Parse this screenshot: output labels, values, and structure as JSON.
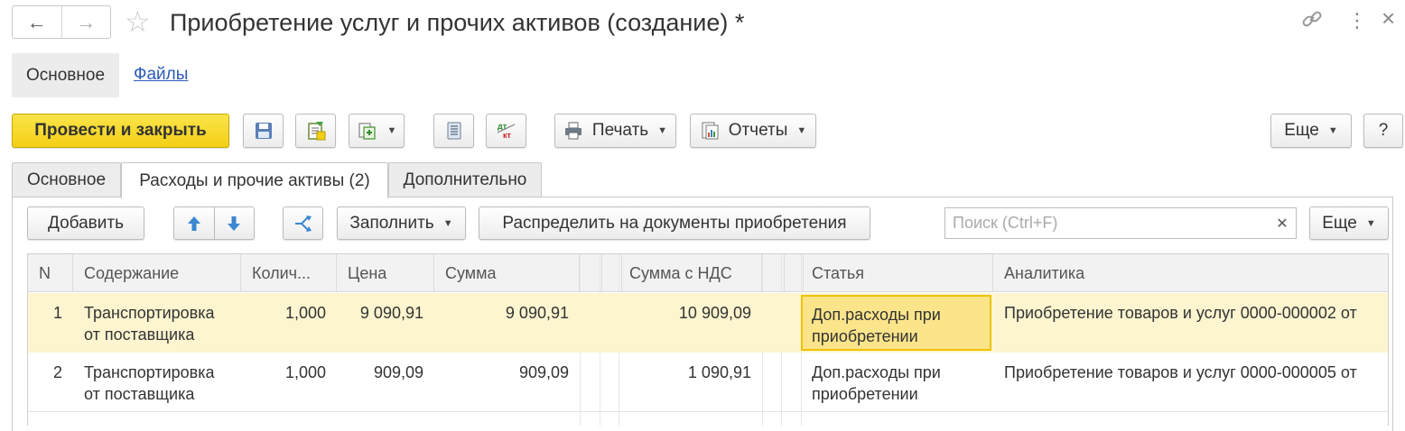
{
  "window": {
    "title": "Приобретение услуг и прочих активов (создание) *",
    "back_icon": "←",
    "forward_icon": "→",
    "star_icon": "☆",
    "link_icon": "🔗",
    "more_icon": "⋮",
    "close_icon": "×"
  },
  "sections": {
    "main": "Основное",
    "files": "Файлы"
  },
  "toolbar": {
    "post_close": "Провести и закрыть",
    "print": "Печать",
    "reports": "Отчеты",
    "more": "Еще",
    "help": "?"
  },
  "tabs": [
    {
      "label": "Основное"
    },
    {
      "label": "Расходы и прочие активы (2)"
    },
    {
      "label": "Дополнительно"
    }
  ],
  "table_toolbar": {
    "add": "Добавить",
    "fill": "Заполнить",
    "distribute": "Распределить на документы приобретения",
    "search_placeholder": "Поиск (Ctrl+F)",
    "more": "Еще"
  },
  "table": {
    "columns": [
      "N",
      "Содержание",
      "Колич...",
      "Цена",
      "Сумма",
      "Сумма с НДС",
      "Статья",
      "Аналитика"
    ],
    "rows": [
      {
        "n": "1",
        "content": "Транспортировка от поставщика",
        "qty": "1,000",
        "price": "9 090,91",
        "sum": "9 090,91",
        "sum_vat": "10 909,09",
        "article": "Доп.расходы при приобретении",
        "analytics": "Приобретение товаров и услуг 0000-000002 от"
      },
      {
        "n": "2",
        "content": "Транспортировка от поставщика",
        "qty": "1,000",
        "price": "909,09",
        "sum": "909,09",
        "sum_vat": "1 090,91",
        "article": "Доп.расходы при приобретении",
        "analytics": "Приобретение товаров и услуг 0000-000005 от"
      }
    ]
  },
  "colors": {
    "primary_button": "#f3cf16",
    "selected_row": "#fdf5cf",
    "focused_cell": "#fbe48a",
    "link": "#2b5ab8"
  }
}
